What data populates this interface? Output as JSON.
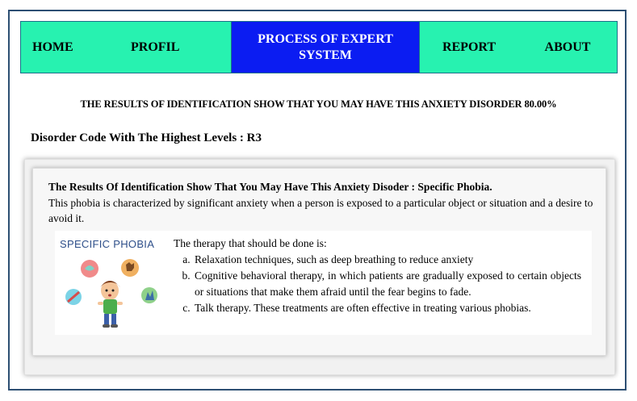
{
  "nav": {
    "home": "HOME",
    "profil": "PROFIL",
    "process": "PROCESS OF EXPERT SYSTEM",
    "report": "REPORT",
    "about": "ABOUT"
  },
  "result": {
    "headline": "THE RESULTS OF IDENTIFICATION SHOW THAT YOU MAY HAVE THIS ANXIETY DISORDER 80.00%",
    "code_line": "Disorder Code With The Highest Levels : R3"
  },
  "card": {
    "title": "The Results Of Identification Show That You May Have This Anxiety Disoder : Specific Phobia.",
    "description": "This phobia is characterized by significant anxiety when a person is exposed to a particular object or situation and a desire to avoid it.",
    "image_caption": "SPECIFIC PHOBIA",
    "therapy_intro": "The therapy that should be done is:",
    "therapy_items": [
      "Relaxation techniques, such as deep breathing to reduce anxiety",
      "Cognitive behavioral therapy, in which patients are gradually exposed to certain objects or situations that make them afraid until the fear begins to fade.",
      "Talk therapy. These treatments are often effective in treating various phobias."
    ]
  },
  "colors": {
    "nav_bg": "#27f2b0",
    "nav_active": "#0b1cf2",
    "frame_border": "#2d4f73"
  }
}
